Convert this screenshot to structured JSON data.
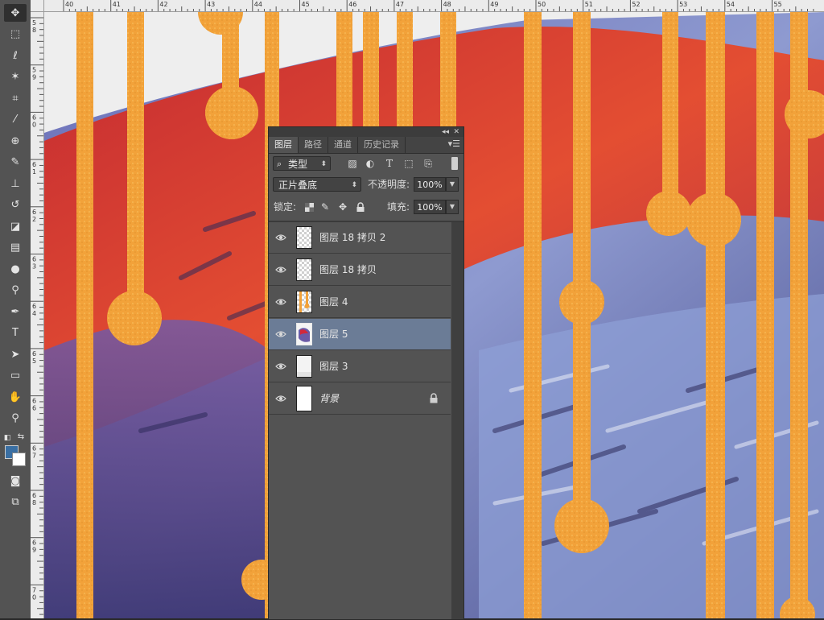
{
  "ruler": {
    "top_labels": [
      "40",
      "41",
      "42",
      "43",
      "44",
      "45",
      "46",
      "47",
      "48",
      "49",
      "50",
      "51",
      "52",
      "53",
      "54",
      "55"
    ],
    "left_labels": [
      "58",
      "59",
      "60",
      "61",
      "62",
      "63",
      "64",
      "65",
      "66",
      "67",
      "68",
      "69",
      "70"
    ]
  },
  "tools": [
    {
      "name": "move-tool-icon",
      "glyph": "✥"
    },
    {
      "name": "marquee-tool-icon",
      "glyph": "⬚"
    },
    {
      "name": "lasso-tool-icon",
      "glyph": "ℓ"
    },
    {
      "name": "magic-wand-tool-icon",
      "glyph": "✶"
    },
    {
      "name": "crop-tool-icon",
      "glyph": "⌗"
    },
    {
      "name": "eyedropper-tool-icon",
      "glyph": "⁄"
    },
    {
      "name": "healing-brush-tool-icon",
      "glyph": "⊕"
    },
    {
      "name": "brush-tool-icon",
      "glyph": "✎"
    },
    {
      "name": "clone-stamp-tool-icon",
      "glyph": "⊥"
    },
    {
      "name": "history-brush-tool-icon",
      "glyph": "↺"
    },
    {
      "name": "eraser-tool-icon",
      "glyph": "◪"
    },
    {
      "name": "gradient-tool-icon",
      "glyph": "▤"
    },
    {
      "name": "blur-tool-icon",
      "glyph": "●"
    },
    {
      "name": "dodge-tool-icon",
      "glyph": "⚲"
    },
    {
      "name": "pen-tool-icon",
      "glyph": "✒"
    },
    {
      "name": "type-tool-icon",
      "glyph": "T"
    },
    {
      "name": "path-selection-tool-icon",
      "glyph": "➤"
    },
    {
      "name": "rectangle-tool-icon",
      "glyph": "▭"
    },
    {
      "name": "hand-tool-icon",
      "glyph": "✋"
    },
    {
      "name": "zoom-tool-icon",
      "glyph": "⚲"
    }
  ],
  "colors": {
    "foreground": "#3a6fa3",
    "background": "#ffffff",
    "selected_layer": "#6b7c96",
    "panel_bg": "#535353"
  },
  "panel": {
    "tabs": [
      "图层",
      "路径",
      "通道",
      "历史记录"
    ],
    "active_tab": "图层",
    "filter_kind": "类型",
    "blend_mode": "正片叠底",
    "opacity_label": "不透明度:",
    "opacity_value": "100%",
    "lock_label": "锁定:",
    "fill_label": "填充:",
    "fill_value": "100%",
    "layers": [
      {
        "name": "图层 18 拷贝 2",
        "thumb": "transparent",
        "selected": false,
        "visible": true,
        "locked": false
      },
      {
        "name": "图层 18 拷贝",
        "thumb": "transparent",
        "selected": false,
        "visible": true,
        "locked": false
      },
      {
        "name": "图层 4",
        "thumb": "gold-strips",
        "selected": false,
        "visible": true,
        "locked": false
      },
      {
        "name": "图层 5",
        "thumb": "painting",
        "selected": true,
        "visible": true,
        "locked": false
      },
      {
        "name": "图层 3",
        "thumb": "white",
        "selected": false,
        "visible": true,
        "locked": false
      },
      {
        "name": "背景",
        "thumb": "white",
        "selected": false,
        "visible": true,
        "locked": true
      }
    ]
  }
}
